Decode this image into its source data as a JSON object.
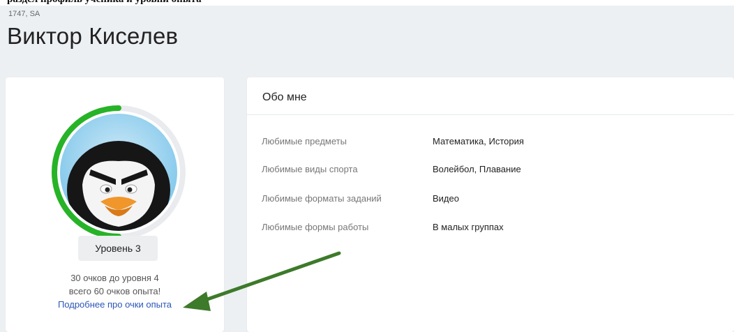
{
  "header": {
    "cropped_heading": "раздел профиль ученика и уровни опыта",
    "user_id": "1747, SA",
    "user_name": "Виктор Киселев"
  },
  "profile": {
    "avatar_icon": "penguin-avatar-icon",
    "level_label": "Уровень 3",
    "level_progress": 0.5,
    "progress_color": "#27b327",
    "xp_to_next": "30 очков до уровня 4",
    "xp_total": "всего 60 очков опыта!",
    "xp_link": "Подробнее про очки опыта"
  },
  "about": {
    "title": "Обо мне",
    "rows": [
      {
        "label": "Любимые предметы",
        "value": "Математика, История"
      },
      {
        "label": "Любимые виды спорта",
        "value": "Волейбол, Плавание"
      },
      {
        "label": "Любимые форматы заданий",
        "value": "Видео"
      },
      {
        "label": "Любимые формы работы",
        "value": "В малых группах"
      }
    ]
  },
  "annotation": {
    "arrow_color": "#3d7a2a"
  }
}
